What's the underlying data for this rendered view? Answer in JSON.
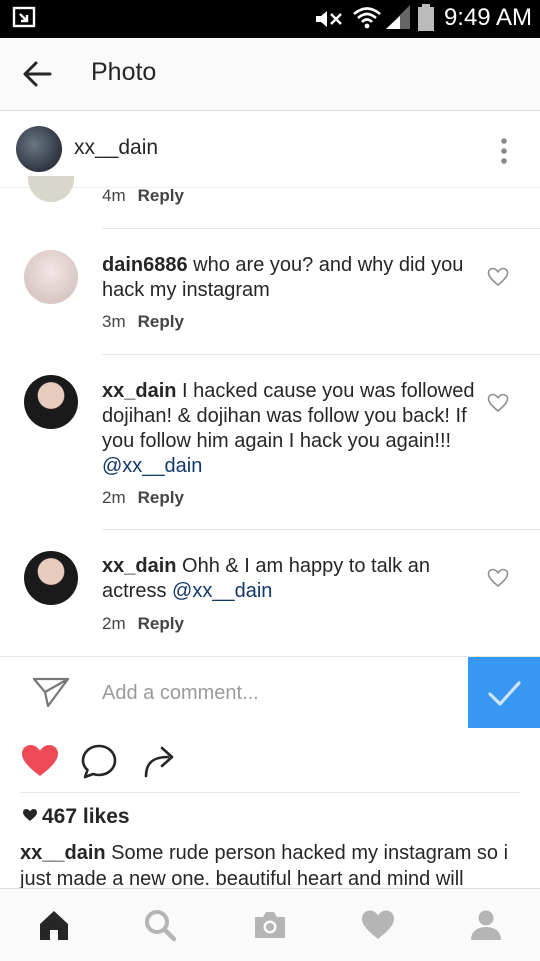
{
  "status_bar": {
    "time": "9:49 AM"
  },
  "header": {
    "title": "Photo"
  },
  "post": {
    "username": "xx__dain"
  },
  "comments": [
    {
      "time": "4m",
      "reply": "Reply"
    },
    {
      "user": "dain6886",
      "text": "who are you? and why did you hack my instagram",
      "time": "3m",
      "reply": "Reply"
    },
    {
      "user": "xx_dain",
      "text": "I hacked cause you was followed dojihan! & dojihan was follow you back! If you follow him again I hack you again!!!",
      "mention": "@xx__dain",
      "time": "2m",
      "reply": "Reply"
    },
    {
      "user": "xx_dain",
      "text": "Ohh & I am happy to talk an actress",
      "mention": "@xx__dain",
      "time": "2m",
      "reply": "Reply"
    }
  ],
  "add_comment": {
    "placeholder": "Add a comment..."
  },
  "likes": "467 likes",
  "caption": {
    "user": "xx__dain",
    "text": "Some rude person hacked my instagram so i just made a new one. beautiful heart and mind will"
  },
  "colors": {
    "accent": "#3897f0",
    "like": "#ed4956",
    "mention": "#12386b"
  }
}
